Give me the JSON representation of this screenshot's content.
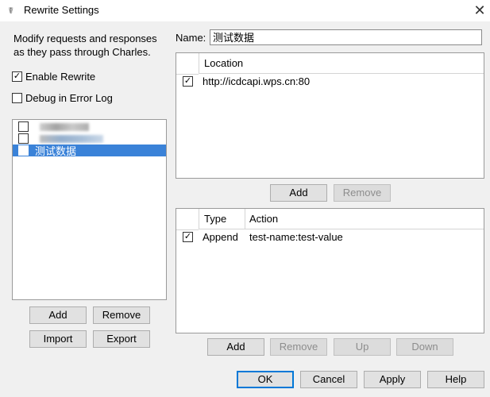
{
  "window": {
    "title": "Rewrite Settings",
    "close_glyph": "✕",
    "app_icon_glyph": "☤"
  },
  "left": {
    "description": "Modify requests and responses as they pass through Charles.",
    "enable_rewrite": {
      "label": "Enable Rewrite",
      "checked": true
    },
    "debug_log": {
      "label": "Debug in Error Log",
      "checked": false
    },
    "sets": [
      {
        "label": "",
        "checked": false,
        "blurred": true,
        "selected": false
      },
      {
        "label": "",
        "checked": false,
        "blurred": true,
        "selected": false
      },
      {
        "label": "测试数据",
        "checked": false,
        "blurred": false,
        "selected": true
      }
    ],
    "add_label": "Add",
    "remove_label": "Remove",
    "import_label": "Import",
    "export_label": "Export"
  },
  "name": {
    "label": "Name:",
    "value": "测试数据"
  },
  "locations": {
    "header": "Location",
    "rows": [
      {
        "checked": true,
        "value": "http://icdcapi.wps.cn:80"
      }
    ],
    "add_label": "Add",
    "remove_label": "Remove"
  },
  "rules": {
    "headers": {
      "type": "Type",
      "action": "Action"
    },
    "rows": [
      {
        "checked": true,
        "type": "Append",
        "action": "test-name:test-value"
      }
    ],
    "add_label": "Add",
    "remove_label": "Remove",
    "up_label": "Up",
    "down_label": "Down"
  },
  "footer": {
    "ok_label": "OK",
    "cancel_label": "Cancel",
    "apply_label": "Apply",
    "help_label": "Help"
  },
  "check_glyph": "✓"
}
